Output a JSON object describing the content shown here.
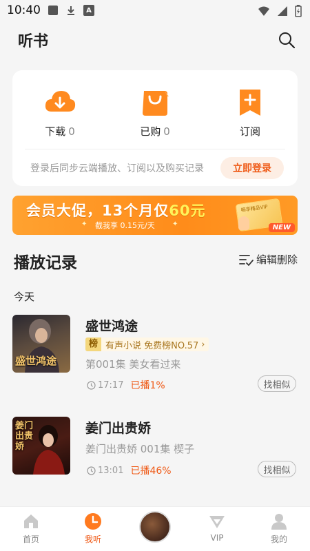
{
  "status_bar": {
    "time": "10:40",
    "indicator": "A"
  },
  "header": {
    "title": "听书"
  },
  "quick_actions": [
    {
      "label": "下载",
      "count": "0"
    },
    {
      "label": "已购",
      "count": "0"
    },
    {
      "label": "订阅",
      "count": ""
    }
  ],
  "login": {
    "hint": "登录后同步云端播放、订阅以及购买记录",
    "button": "立即登录"
  },
  "banner": {
    "title_prefix": "会员大促，13个月仅",
    "title_highlight": "60元",
    "subtitle": "截我享 0.15元/天",
    "card_text": "畅享精品VIP",
    "badge": "NEW"
  },
  "section": {
    "title": "播放记录",
    "edit_label": "编辑删除",
    "date_label": "今天"
  },
  "history": [
    {
      "title": "盛世鸿途",
      "cover_text": "盛世鸿途",
      "rank_badge": "榜",
      "rank_text": "有声小说 免费榜NO.57",
      "episode": "第001集 美女看过来",
      "time": "17:17",
      "played": "已播1%",
      "similar": "找相似"
    },
    {
      "title": "姜门出贵娇",
      "cover_text": "姜门出贵娇",
      "episode": "姜门出贵娇 001集  楔子",
      "time": "13:01",
      "played": "已播46%",
      "similar": "找相似"
    }
  ],
  "tabs": [
    {
      "label": "首页"
    },
    {
      "label": "我听"
    },
    {
      "label": ""
    },
    {
      "label": "VIP"
    },
    {
      "label": "我的"
    }
  ],
  "colors": {
    "accent": "#ef5a17",
    "icon_orange": "#ff8a1f",
    "background": "#f5f5f5"
  }
}
